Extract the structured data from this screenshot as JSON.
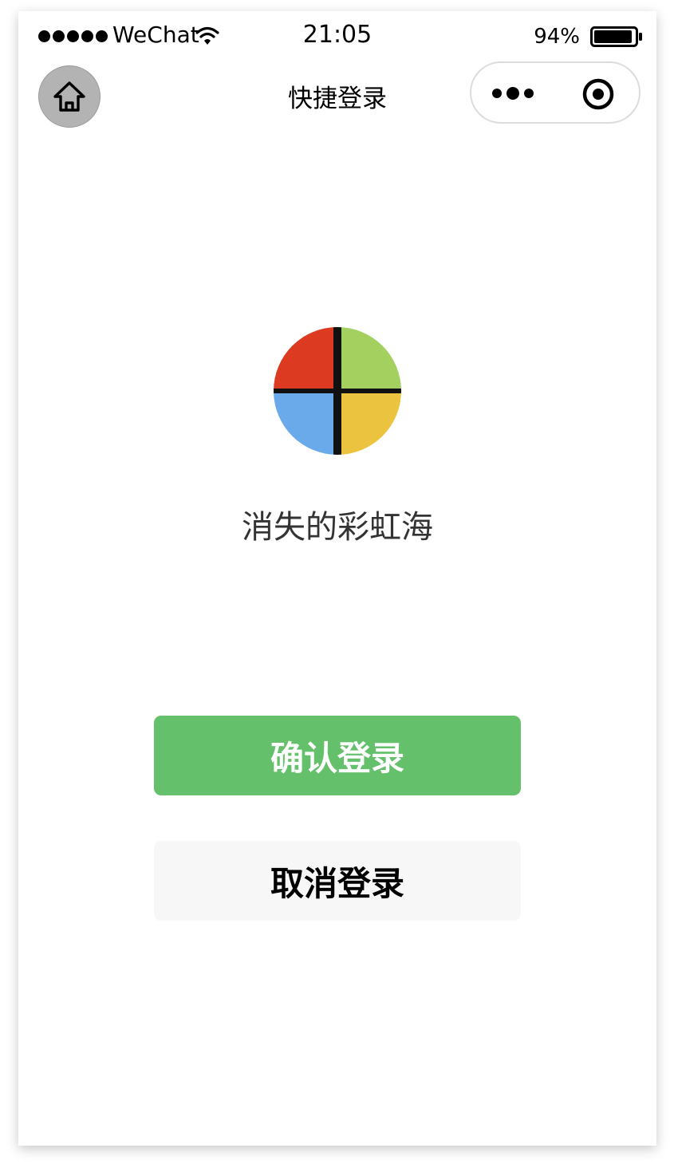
{
  "status_bar": {
    "carrier": "WeChat",
    "time": "21:05",
    "battery": "94%",
    "battery_level": 0.94,
    "signal_bars": 5
  },
  "nav": {
    "title": "快捷登录",
    "home_icon": "home-icon",
    "more_icon": "more-dots-icon",
    "close_icon": "target-circle-icon"
  },
  "app": {
    "name": "消失的彩虹海",
    "logo_colors": {
      "top_left": "#dd3a22",
      "top_right": "#a3d05f",
      "bottom_left": "#6aaaea",
      "bottom_right": "#ecc33e"
    }
  },
  "actions": {
    "confirm_label": "确认登录",
    "cancel_label": "取消登录",
    "confirm_color": "#64c06b",
    "cancel_color": "#f7f7f7"
  }
}
